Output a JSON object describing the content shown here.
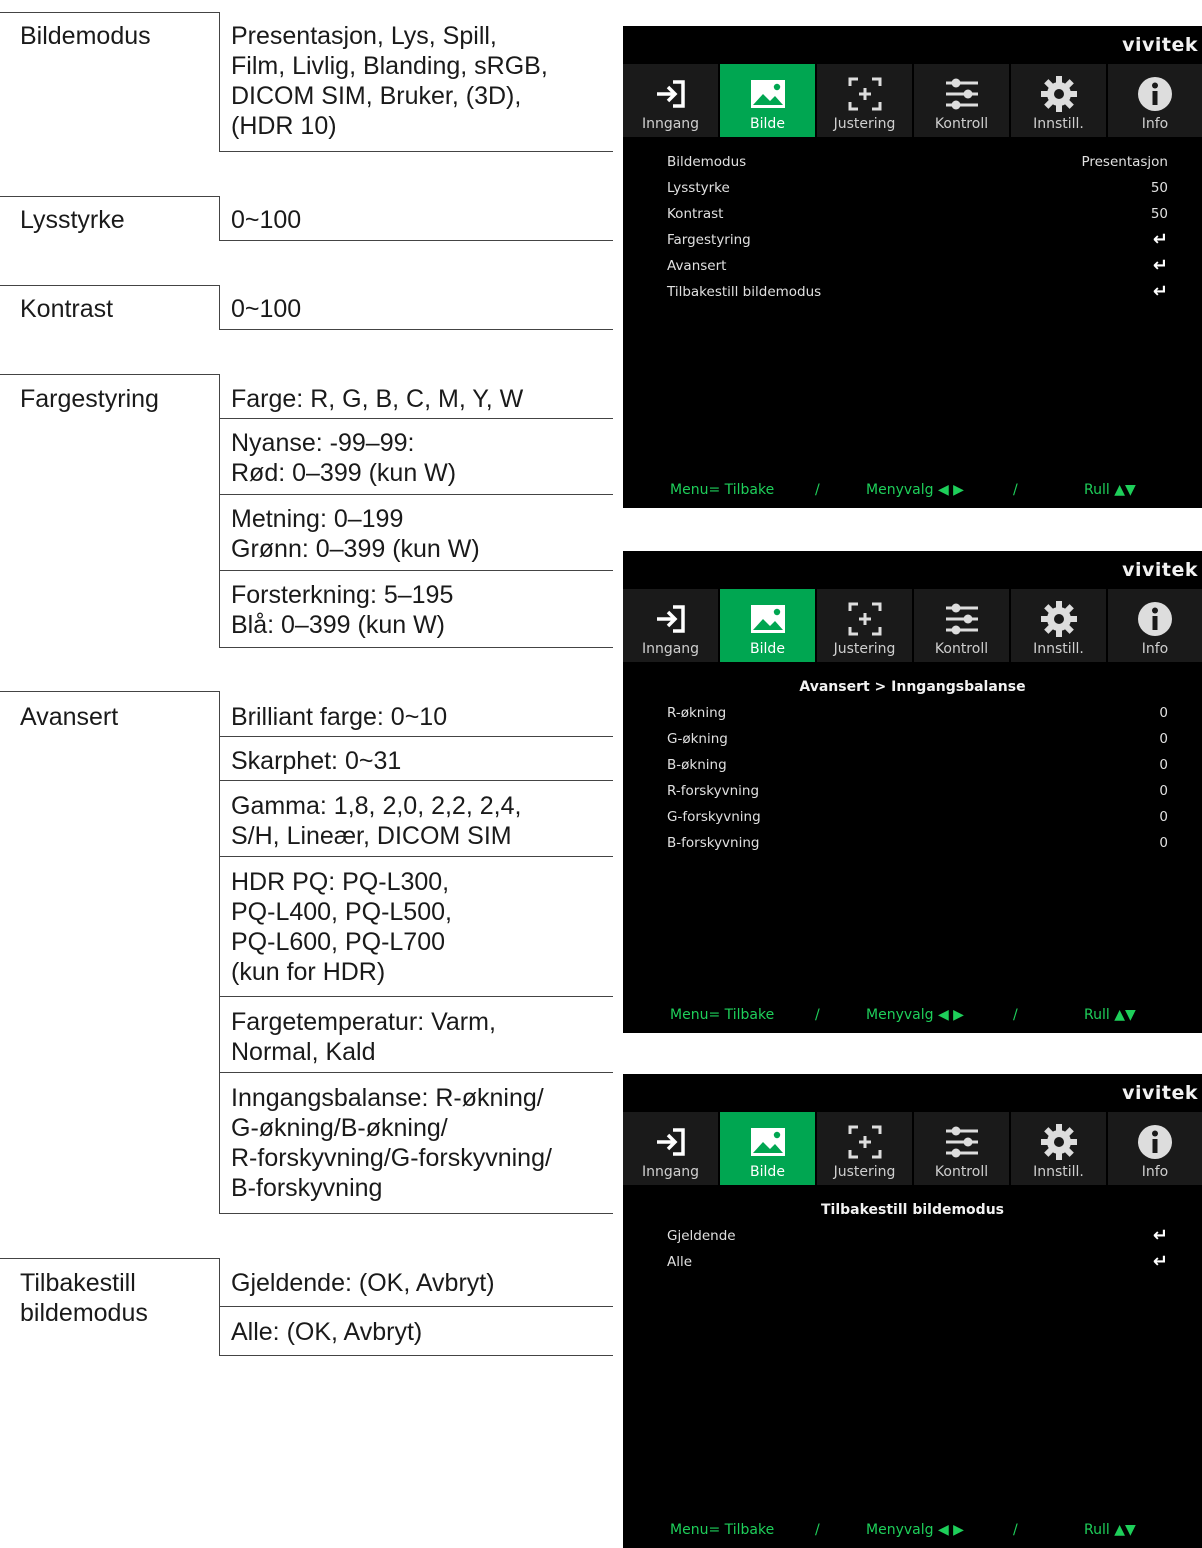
{
  "table": {
    "bildemodus": {
      "label": "Bildemodus",
      "value": "Presentasjon, Lys, Spill,\nFilm, Livlig, Blanding, sRGB,\nDICOM SIM, Bruker, (3D),\n(HDR 10)"
    },
    "lysstyrke": {
      "label": "Lysstyrke",
      "value": "0~100"
    },
    "kontrast": {
      "label": "Kontrast",
      "value": "0~100"
    },
    "fargestyring": {
      "label": "Fargestyring",
      "values": [
        "Farge: R, G, B, C, M, Y, W",
        "Nyanse: -99–99:\nRød: 0–399 (kun W)",
        "Metning: 0–199\nGrønn: 0–399 (kun W)",
        "Forsterkning: 5–195\nBlå: 0–399 (kun W)"
      ]
    },
    "avansert": {
      "label": "Avansert",
      "values": [
        "Brilliant farge: 0~10",
        "Skarphet: 0~31",
        "Gamma: 1,8, 2,0, 2,2, 2,4,\nS/H, Lineær, DICOM SIM",
        "HDR PQ: PQ-L300,\nPQ-L400, PQ-L500,\nPQ-L600, PQ-L700\n(kun for HDR)",
        "Fargetemperatur: Varm,\nNormal, Kald",
        "Inngangsbalanse: R-økning/\nG-økning/B-økning/\nR-forskyvning/G-forskyvning/\nB-forskyvning"
      ]
    },
    "tilbakestill": {
      "label": "Tilbakestill\nbildemodus",
      "values": [
        "Gjeldende: (OK, Avbryt)",
        "Alle: (OK, Avbryt)"
      ]
    }
  },
  "osd": {
    "brand": "vivitek",
    "tabs": [
      {
        "label": "Inngang",
        "icon": "input-icon"
      },
      {
        "label": "Bilde",
        "icon": "picture-icon"
      },
      {
        "label": "Justering",
        "icon": "adjust-icon"
      },
      {
        "label": "Kontroll",
        "icon": "sliders-icon"
      },
      {
        "label": "Innstill.",
        "icon": "gear-icon"
      },
      {
        "label": "Info",
        "icon": "info-icon"
      }
    ],
    "active_tab": "Bilde",
    "accent": "#00a651",
    "footer": {
      "menu": "Menu= Tilbake",
      "sep": "/",
      "menyvalg": "Menyvalg ◀ ▶",
      "rull": "Rull ▲▼"
    },
    "screen1": {
      "rows": [
        {
          "label": "Bildemodus",
          "value": "Presentasjon"
        },
        {
          "label": "Lysstyrke",
          "value": "50"
        },
        {
          "label": "Kontrast",
          "value": "50"
        },
        {
          "label": "Fargestyring",
          "value": "↵"
        },
        {
          "label": "Avansert",
          "value": "↵"
        },
        {
          "label": "Tilbakestill bildemodus",
          "value": "↵"
        }
      ]
    },
    "screen2": {
      "title": "Avansert > Inngangsbalanse",
      "rows": [
        {
          "label": "R-økning",
          "value": "0"
        },
        {
          "label": "G-økning",
          "value": "0"
        },
        {
          "label": "B-økning",
          "value": "0"
        },
        {
          "label": "R-forskyvning",
          "value": "0"
        },
        {
          "label": "G-forskyvning",
          "value": "0"
        },
        {
          "label": "B-forskyvning",
          "value": "0"
        }
      ]
    },
    "screen3": {
      "title": "Tilbakestill bildemodus",
      "rows": [
        {
          "label": "Gjeldende",
          "value": "↵"
        },
        {
          "label": "Alle",
          "value": "↵"
        }
      ]
    }
  }
}
